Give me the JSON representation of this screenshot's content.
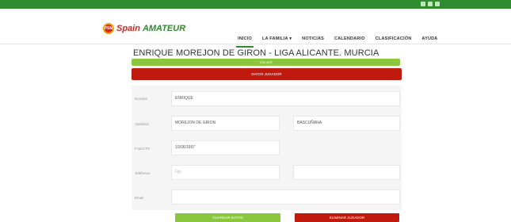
{
  "brand": {
    "badge": "PSM",
    "spain": "Spain",
    "amateur": "AMATEUR"
  },
  "nav": [
    {
      "label": "INICIO"
    },
    {
      "label": "LA FAMILIA ▾"
    },
    {
      "label": "NOTICIAS"
    },
    {
      "label": "CALENDARIO"
    },
    {
      "label": "CLASIFICACIÓN"
    },
    {
      "label": "AYUDA"
    }
  ],
  "page": {
    "title": "ENRIQUE MOREJON DE GIRON - LIGA ALICANTE. MURCIA"
  },
  "actions": {
    "volver": "VOLVER",
    "datos": "DATOS JUGADOR",
    "guardar": "GUARDAR DATOS",
    "eliminar": "ELIMINAR JUGADOR"
  },
  "form": {
    "nombre_label": "Nombre",
    "nombre_value": "ENRIQUE",
    "apellidos_label": "Apellidos",
    "apellido1_value": "MOREJON DE GIRON",
    "apellido2_value": "BASCUÑANA",
    "fnac_label": "F.NACTO",
    "fnac_value": "10/06/1997",
    "telefono_label": "Teléfonos",
    "telefono1_placeholder": "Fijo",
    "telefono2_value": "",
    "email_label": "Email",
    "email_value": ""
  },
  "colors": {
    "primary_green": "#2e8b2e",
    "light_green": "#8cc63f",
    "red": "#c0190e"
  }
}
